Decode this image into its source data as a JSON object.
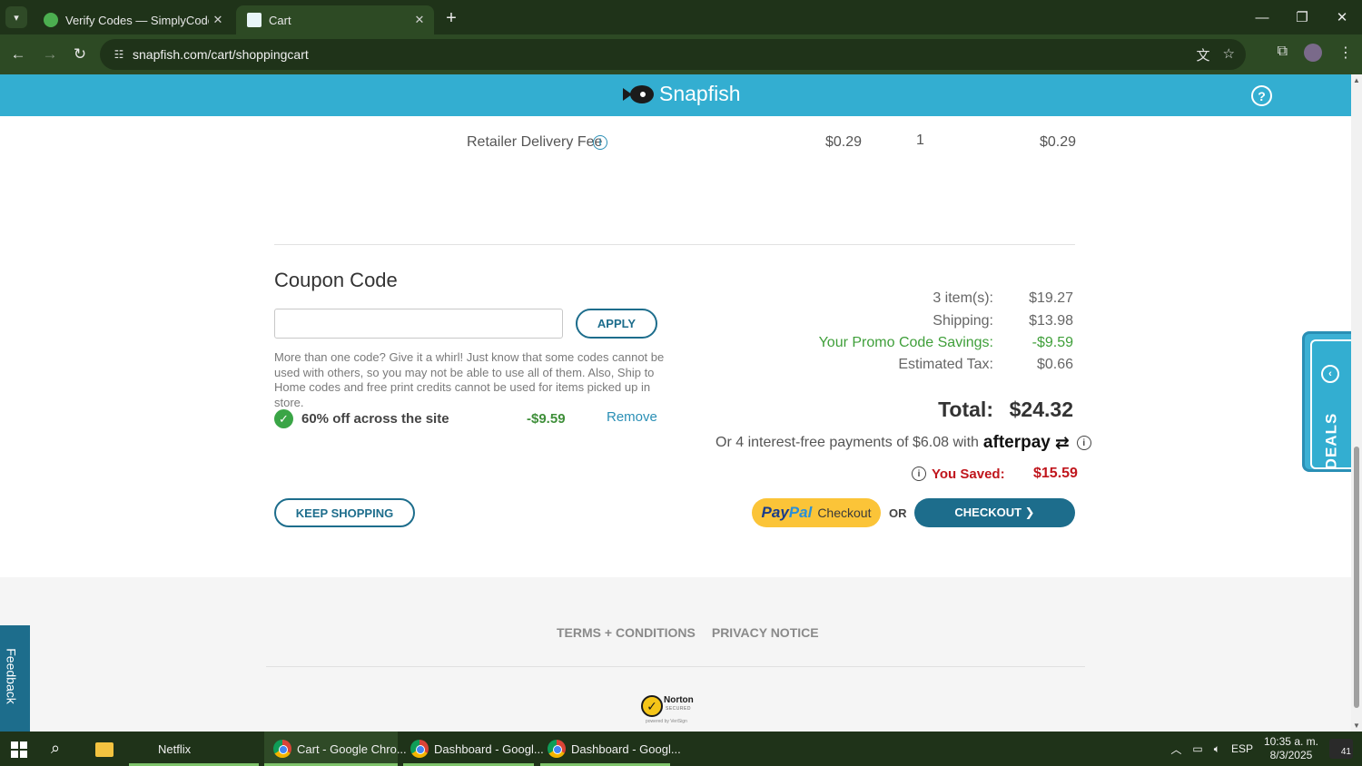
{
  "browser": {
    "tabs": [
      {
        "title": "Verify Codes — SimplyCodes",
        "active": false
      },
      {
        "title": "Cart",
        "active": true
      }
    ],
    "url": "snapfish.com/cart/shoppingcart"
  },
  "site": {
    "brand": "Snapfish",
    "help_label": "?"
  },
  "fee_row": {
    "label": "Retailer Delivery Fee",
    "price": "$0.29",
    "qty": "1",
    "total": "$0.29"
  },
  "coupon": {
    "heading": "Coupon Code",
    "input_value": "",
    "apply_label": "APPLY",
    "note": "More than one code? Give it a whirl! Just know that some codes cannot be used with others, so you may not be able to use all of them. Also, Ship to Home codes and free print credits cannot be used for items picked up in store.",
    "applied": {
      "name": "60% off across the site",
      "amount": "-$9.59",
      "remove_label": "Remove"
    }
  },
  "summary": {
    "items_label": "3 item(s):",
    "items_value": "$19.27",
    "shipping_label": "Shipping:",
    "shipping_value": "$13.98",
    "promo_label": "Your Promo Code Savings:",
    "promo_value": "-$9.59",
    "tax_label": "Estimated Tax:",
    "tax_value": "$0.66",
    "total_label": "Total:",
    "total_value": "$24.32",
    "afterpay_text": "Or 4 interest-free payments of $6.08 with",
    "afterpay_brand": "afterpay",
    "saved_label": "You Saved:",
    "saved_value": "$15.59"
  },
  "actions": {
    "keep_shopping": "KEEP SHOPPING",
    "paypal_pay": "Pay",
    "paypal_pal": "Pal",
    "paypal_checkout": "Checkout",
    "or": "OR",
    "checkout": "CHECKOUT ❯"
  },
  "deals_label": "DEALS",
  "feedback_label": "Feedback",
  "footer": {
    "terms": "TERMS + CONDITIONS",
    "privacy": "PRIVACY NOTICE",
    "norton_name": "Norton",
    "norton_sub": "SECURED",
    "norton_powered": "powered by VeriSign"
  },
  "taskbar": {
    "items": [
      {
        "label": "Netflix"
      },
      {
        "label": "Cart - Google Chro..."
      },
      {
        "label": "Dashboard - Googl..."
      },
      {
        "label": "Dashboard - Googl..."
      }
    ],
    "lang": "ESP",
    "time": "10:35 a. m.",
    "date": "8/3/2025",
    "notifications": "41"
  },
  "colors": {
    "brand": "#33aed1",
    "primary_button": "#1d6d8c",
    "promo_green": "#3f9f3a",
    "saved_red": "#c0161d",
    "paypal_yellow": "#fbc438"
  }
}
